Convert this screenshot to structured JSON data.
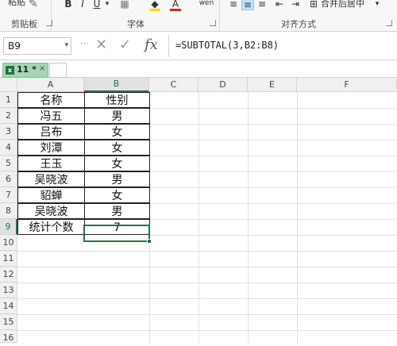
{
  "ribbon": {
    "paste_label_cut": "粘贴",
    "bold": "B",
    "italic": "I",
    "underline": "U",
    "underline_arrow": "▾",
    "border_icon": "▦",
    "fill_icon": "A",
    "font_color": "A",
    "wen": "wén",
    "merge_label": "合并后居中",
    "merge_arrow": "▾",
    "groups": {
      "clipboard": "剪贴板",
      "font": "字体",
      "alignment": "对齐方式"
    },
    "colors": {
      "font_color_bar": "#e02020",
      "fill_color_bar": "#ffd700"
    }
  },
  "formula_bar": {
    "name_box": "B9",
    "name_box_arrow": "▾",
    "cancel_icon": "✕",
    "confirm_icon": "✓",
    "fx_label": "fx",
    "formula": "=SUBTOTAL(3,B2:B8)"
  },
  "tabs": {
    "doc_icon_letter": "x",
    "doc_label": "11 *",
    "close": "×"
  },
  "sheet": {
    "columns": [
      "A",
      "B",
      "C",
      "D",
      "E",
      "F"
    ],
    "rows": [
      "1",
      "2",
      "3",
      "4",
      "5",
      "6",
      "7",
      "8",
      "9",
      "10",
      "11",
      "12",
      "13",
      "14",
      "15",
      "16"
    ],
    "header": [
      "名称",
      "性别"
    ],
    "data": [
      [
        "冯五",
        "男"
      ],
      [
        "吕布",
        "女"
      ],
      [
        "刘潭",
        "女"
      ],
      [
        "王玉",
        "女"
      ],
      [
        "吴晓波",
        "男"
      ],
      [
        "貂蝉",
        "女"
      ],
      [
        "吴晓波",
        "男"
      ]
    ],
    "summary": [
      "统计个数",
      "7"
    ],
    "selected_cell": "B9",
    "accent": "#217346"
  }
}
